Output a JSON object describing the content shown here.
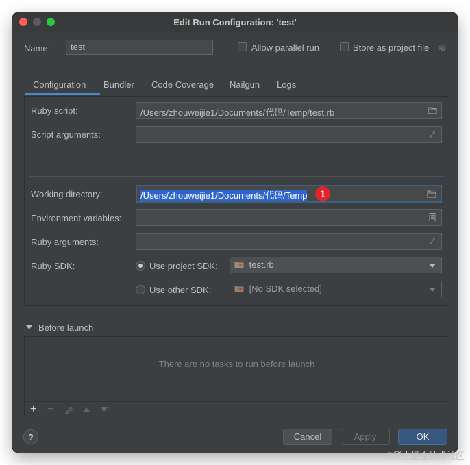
{
  "window": {
    "title": "Edit Run Configuration: 'test'"
  },
  "header": {
    "name_label": "Name:",
    "name_value": "test",
    "allow_parallel_label": "Allow parallel run",
    "store_project_label": "Store as project file"
  },
  "tabs": [
    {
      "label": "Configuration",
      "active": true
    },
    {
      "label": "Bundler"
    },
    {
      "label": "Code Coverage"
    },
    {
      "label": "Nailgun"
    },
    {
      "label": "Logs"
    }
  ],
  "config": {
    "ruby_script_label": "Ruby script:",
    "ruby_script_value": "/Users/zhouweijie1/Documents/代码/Temp/test.rb",
    "script_args_label": "Script arguments:",
    "script_args_value": "",
    "working_dir_label": "Working directory:",
    "working_dir_value": "/Users/zhouweijie1/Documents/代码/Temp",
    "env_vars_label": "Environment variables:",
    "env_vars_value": "",
    "ruby_args_label": "Ruby arguments:",
    "ruby_args_value": "",
    "ruby_sdk_label": "Ruby SDK:",
    "use_project_sdk_label": "Use project SDK:",
    "project_sdk_value": "test.rb",
    "use_other_sdk_label": "Use other SDK:",
    "other_sdk_value": "[No SDK selected]"
  },
  "annotation": {
    "marker": "1",
    "color": "#e0242a"
  },
  "before_launch": {
    "title": "Before launch",
    "empty_text": "There are no tasks to run before launch",
    "toolbar": [
      "add-icon",
      "remove-icon",
      "edit-icon",
      "move-up-icon",
      "move-down-icon"
    ]
  },
  "footer": {
    "help_label": "?",
    "cancel_label": "Cancel",
    "apply_label": "Apply",
    "ok_label": "OK"
  },
  "watermark": "@稀土掘金技术社区",
  "colors": {
    "background": "#3c3f41",
    "accent": "#4a88c7",
    "primary_button": "#365880",
    "selection": "#2f65ca"
  }
}
